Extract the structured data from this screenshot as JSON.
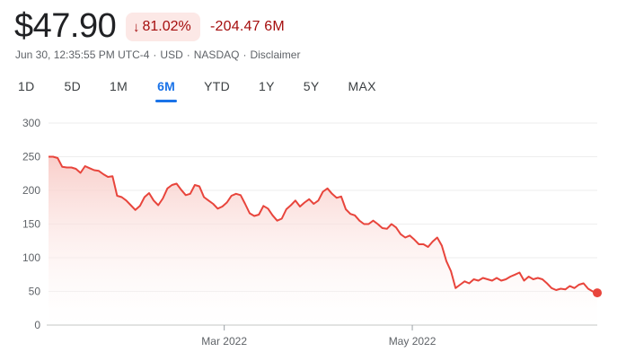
{
  "header": {
    "price": "$47.90",
    "change_percent": "81.02%",
    "change_abs": "-204.47 6M",
    "timestamp": "Jun 30, 12:35:55 PM UTC-4",
    "currency": "USD",
    "exchange": "NASDAQ",
    "disclaimer": "Disclaimer",
    "separator": "·"
  },
  "tabs": [
    {
      "label": "1D"
    },
    {
      "label": "5D"
    },
    {
      "label": "1M"
    },
    {
      "label": "6M",
      "active": true
    },
    {
      "label": "YTD"
    },
    {
      "label": "1Y"
    },
    {
      "label": "5Y"
    },
    {
      "label": "MAX"
    }
  ],
  "colors": {
    "line": "#e8453c",
    "fill_top": "#f8c9c4",
    "negative": "#a50e0e",
    "badge_bg": "#fce8e6",
    "active_tab": "#1a73e8"
  },
  "chart_data": {
    "type": "area",
    "x_start": "2022-01-03",
    "x_end": "2022-06-30",
    "xticks": [
      {
        "date": "2022-03-01",
        "label": "Mar 2022"
      },
      {
        "date": "2022-05-01",
        "label": "May 2022"
      }
    ],
    "ylim": [
      0,
      300
    ],
    "yticks": [
      0,
      50,
      100,
      150,
      200,
      250,
      300
    ],
    "values": [
      250,
      250,
      248,
      235,
      234,
      234,
      232,
      226,
      236,
      233,
      230,
      229,
      224,
      220,
      221,
      192,
      190,
      185,
      178,
      171,
      177,
      190,
      196,
      185,
      178,
      188,
      203,
      208,
      210,
      201,
      193,
      195,
      208,
      206,
      190,
      185,
      180,
      173,
      176,
      182,
      192,
      195,
      193,
      180,
      166,
      162,
      164,
      177,
      173,
      163,
      155,
      158,
      172,
      178,
      185,
      176,
      182,
      187,
      180,
      185,
      198,
      203,
      195,
      189,
      191,
      172,
      165,
      163,
      155,
      150,
      150,
      155,
      150,
      144,
      143,
      150,
      145,
      135,
      130,
      133,
      127,
      120,
      120,
      116,
      124,
      130,
      118,
      95,
      80,
      55,
      60,
      65,
      62,
      68,
      66,
      70,
      68,
      66,
      70,
      66,
      68,
      72,
      75,
      78,
      66,
      72,
      68,
      70,
      68,
      62,
      55,
      52,
      54,
      53,
      58,
      55,
      60,
      62,
      54,
      50,
      47.9
    ]
  }
}
